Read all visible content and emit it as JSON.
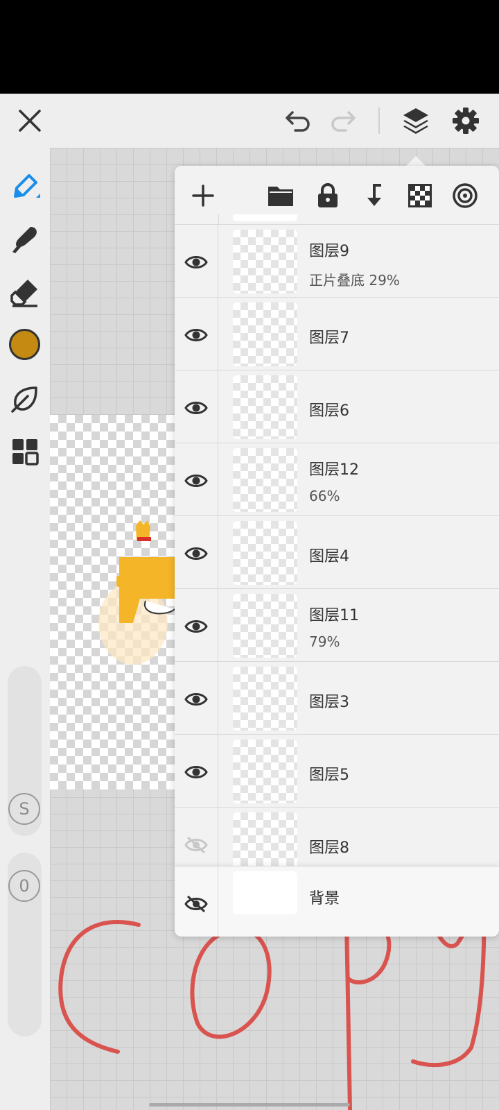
{
  "colors": {
    "accent": "#1a8ee8",
    "current_color": "#c48a12",
    "copy_stroke": "#d9534f"
  },
  "topbar": {
    "icons": [
      "close-icon",
      "undo-icon",
      "redo-icon",
      "layers-icon",
      "settings-icon"
    ]
  },
  "leftbar": {
    "tools": [
      "pen-icon",
      "brush-icon",
      "eraser-icon",
      "color-swatch",
      "leaf-icon",
      "grid-icon"
    ],
    "s_label": "S",
    "zero_label": "0"
  },
  "layer_panel": {
    "toolbar_icons": [
      "add-icon",
      "folder-icon",
      "lock-icon",
      "merge-down-icon",
      "transparency-icon",
      "target-icon"
    ],
    "layers": [
      {
        "name": "图层9",
        "sub": "正片叠底   29%",
        "visible": true
      },
      {
        "name": "图层7",
        "sub": "",
        "visible": true
      },
      {
        "name": "图层6",
        "sub": "",
        "visible": true
      },
      {
        "name": "图层12",
        "sub": "66%",
        "visible": true
      },
      {
        "name": "图层4",
        "sub": "",
        "visible": true
      },
      {
        "name": "图层11",
        "sub": "79%",
        "visible": true
      },
      {
        "name": "图层3",
        "sub": "",
        "visible": true
      },
      {
        "name": "图层5",
        "sub": "",
        "visible": true
      },
      {
        "name": "图层8",
        "sub": "",
        "visible": false
      }
    ],
    "background": {
      "name": "背景",
      "visible": false
    }
  },
  "canvas": {
    "handwriting": "copy"
  }
}
